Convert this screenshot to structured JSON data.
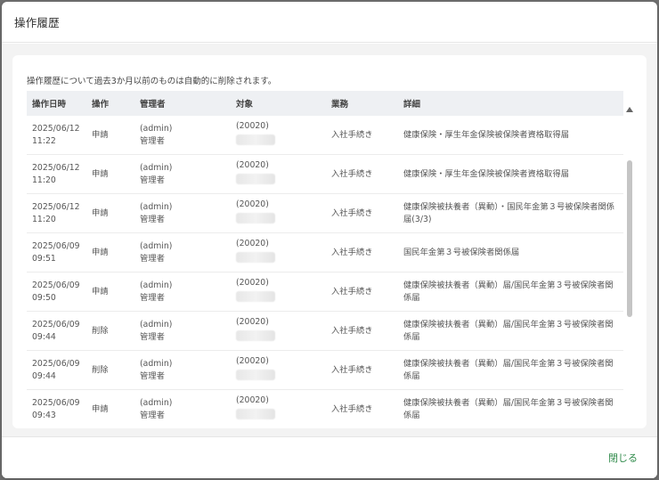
{
  "modal": {
    "title": "操作履歴",
    "notice": "操作履歴について過去3か月以前のものは自動的に削除されます。",
    "close_label": "閉じる"
  },
  "table": {
    "columns": [
      "操作日時",
      "操作",
      "管理者",
      "対象",
      "業務",
      "詳細"
    ],
    "rows": [
      {
        "date": "2025/06/12",
        "time": "11:22",
        "op": "申請",
        "admin_id": "(admin)",
        "admin_name": "管理者",
        "target_id": "(20020)",
        "biz": "入社手続き",
        "detail": "健康保険・厚生年金保険被保険者資格取得届"
      },
      {
        "date": "2025/06/12",
        "time": "11:20",
        "op": "申請",
        "admin_id": "(admin)",
        "admin_name": "管理者",
        "target_id": "(20020)",
        "biz": "入社手続き",
        "detail": "健康保険・厚生年金保険被保険者資格取得届"
      },
      {
        "date": "2025/06/12",
        "time": "11:20",
        "op": "申請",
        "admin_id": "(admin)",
        "admin_name": "管理者",
        "target_id": "(20020)",
        "biz": "入社手続き",
        "detail": "健康保険被扶養者（異動）・国民年金第３号被保険者関係届(3/3)"
      },
      {
        "date": "2025/06/09",
        "time": "09:51",
        "op": "申請",
        "admin_id": "(admin)",
        "admin_name": "管理者",
        "target_id": "(20020)",
        "biz": "入社手続き",
        "detail": "国民年金第３号被保険者関係届"
      },
      {
        "date": "2025/06/09",
        "time": "09:50",
        "op": "申請",
        "admin_id": "(admin)",
        "admin_name": "管理者",
        "target_id": "(20020)",
        "biz": "入社手続き",
        "detail": "健康保険被扶養者（異動）届/国民年金第３号被保険者関係届"
      },
      {
        "date": "2025/06/09",
        "time": "09:44",
        "op": "削除",
        "admin_id": "(admin)",
        "admin_name": "管理者",
        "target_id": "(20020)",
        "biz": "入社手続き",
        "detail": "健康保険被扶養者（異動）届/国民年金第３号被保険者関係届"
      },
      {
        "date": "2025/06/09",
        "time": "09:44",
        "op": "削除",
        "admin_id": "(admin)",
        "admin_name": "管理者",
        "target_id": "(20020)",
        "biz": "入社手続き",
        "detail": "健康保険被扶養者（異動）届/国民年金第３号被保険者関係届"
      },
      {
        "date": "2025/06/09",
        "time": "09:43",
        "op": "申請",
        "admin_id": "(admin)",
        "admin_name": "管理者",
        "target_id": "(20020)",
        "biz": "入社手続き",
        "detail": "健康保険被扶養者（異動）届/国民年金第３号被保険者関係届"
      }
    ]
  },
  "icons": {
    "scroll_up": "scroll-up-arrow-icon",
    "scroll_down": "scroll-down-arrow-icon"
  },
  "colors": {
    "accent": "#2f8a4a",
    "header_bg": "#eef0f3",
    "body_bg": "#f3f3f3"
  }
}
